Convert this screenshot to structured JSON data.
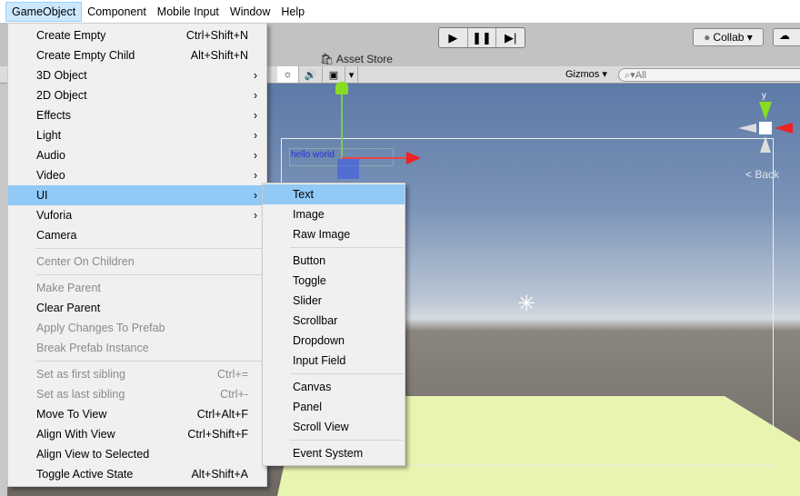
{
  "menubar": [
    "GameObject",
    "Component",
    "Mobile Input",
    "Window",
    "Help"
  ],
  "toolbar": {
    "play": "▶",
    "pause": "❚❚",
    "step": "▶|",
    "collab": "Collab ▾",
    "asset_store": "Asset Store",
    "gizmos": "Gizmos ▾",
    "search_placeholder": "All",
    "audio": "🔊",
    "fx": "▾"
  },
  "scene": {
    "hello_text": "hello world",
    "back_label": "< Back",
    "axis_y": "y"
  },
  "menu": [
    {
      "label": "Create Empty",
      "shortcut": "Ctrl+Shift+N"
    },
    {
      "label": "Create Empty Child",
      "shortcut": "Alt+Shift+N"
    },
    {
      "label": "3D Object",
      "arrow": true
    },
    {
      "label": "2D Object",
      "arrow": true
    },
    {
      "label": "Effects",
      "arrow": true
    },
    {
      "label": "Light",
      "arrow": true
    },
    {
      "label": "Audio",
      "arrow": true
    },
    {
      "label": "Video",
      "arrow": true
    },
    {
      "label": "UI",
      "arrow": true,
      "highlighted": true
    },
    {
      "label": "Vuforia",
      "arrow": true
    },
    {
      "label": "Camera"
    },
    {
      "sep": true
    },
    {
      "label": "Center On Children",
      "disabled": true
    },
    {
      "sep": true
    },
    {
      "label": "Make Parent",
      "disabled": true
    },
    {
      "label": "Clear Parent"
    },
    {
      "label": "Apply Changes To Prefab",
      "disabled": true
    },
    {
      "label": "Break Prefab Instance",
      "disabled": true
    },
    {
      "sep": true
    },
    {
      "label": "Set as first sibling",
      "shortcut": "Ctrl+=",
      "disabled": true
    },
    {
      "label": "Set as last sibling",
      "shortcut": "Ctrl+-",
      "disabled": true
    },
    {
      "label": "Move To View",
      "shortcut": "Ctrl+Alt+F"
    },
    {
      "label": "Align With View",
      "shortcut": "Ctrl+Shift+F"
    },
    {
      "label": "Align View to Selected"
    },
    {
      "label": "Toggle Active State",
      "shortcut": "Alt+Shift+A"
    }
  ],
  "submenu": [
    {
      "label": "Text",
      "highlighted": true
    },
    {
      "label": "Image"
    },
    {
      "label": "Raw Image"
    },
    {
      "sep": true
    },
    {
      "label": "Button"
    },
    {
      "label": "Toggle"
    },
    {
      "label": "Slider"
    },
    {
      "label": "Scrollbar"
    },
    {
      "label": "Dropdown"
    },
    {
      "label": "Input Field"
    },
    {
      "sep": true
    },
    {
      "label": "Canvas"
    },
    {
      "label": "Panel"
    },
    {
      "label": "Scroll View"
    },
    {
      "sep": true
    },
    {
      "label": "Event System"
    }
  ]
}
